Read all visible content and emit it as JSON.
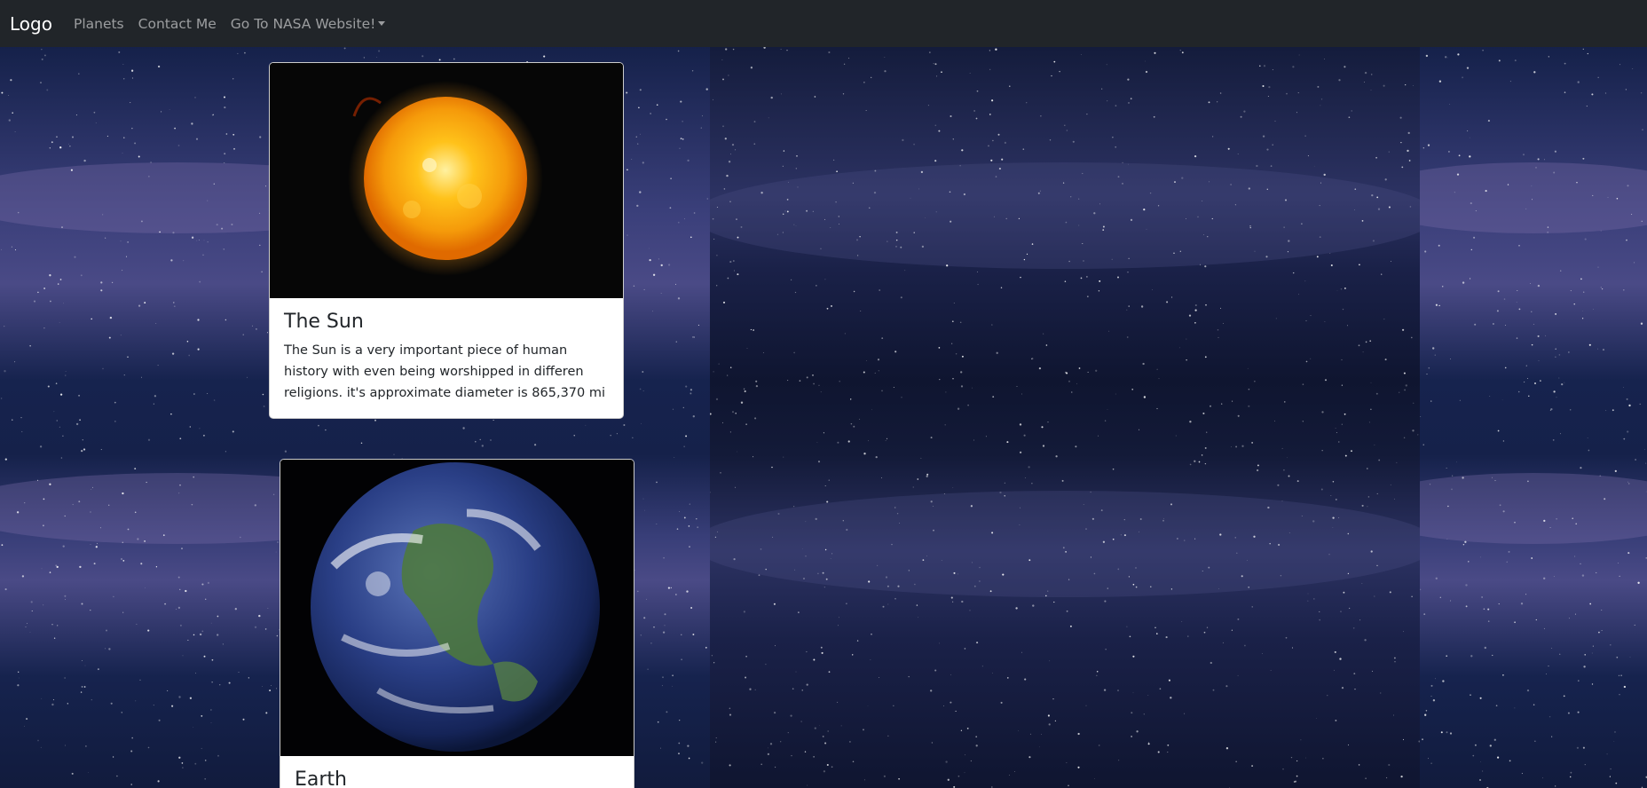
{
  "navbar": {
    "brand": "Logo",
    "links": [
      {
        "label": "Planets"
      },
      {
        "label": "Contact Me"
      },
      {
        "label": "Go To NASA Website!",
        "dropdown": true
      }
    ],
    "background_color": "#212529"
  },
  "cards": [
    {
      "title": "The Sun",
      "text": "The Sun is a very important piece of human history with even being worshipped in differen religions. it's approximate diameter is 865,370 mi",
      "image": "sun-image"
    },
    {
      "title": "Earth",
      "text": "",
      "image": "earth-image"
    }
  ],
  "colors": {
    "page_background": "#0b1023",
    "card_background": "#ffffff",
    "text": "#212529",
    "nav_link": "rgba(255,255,255,0.55)"
  }
}
